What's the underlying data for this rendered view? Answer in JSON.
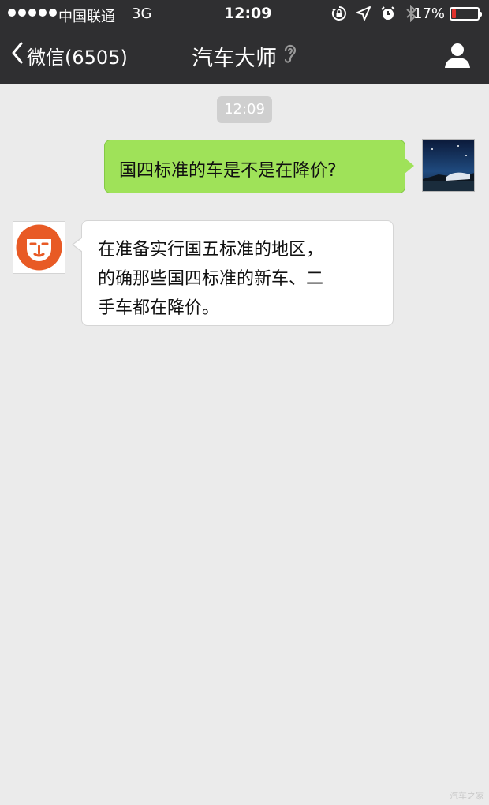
{
  "status_bar": {
    "carrier": "中国联通",
    "network": "3G",
    "time": "12:09",
    "battery_text": "17%",
    "battery_level": 0.17,
    "battery_color": "#e0322d",
    "icons": [
      "signal-dots-icon",
      "rotation-lock-icon",
      "location-arrow-icon",
      "alarm-icon",
      "bluetooth-icon",
      "battery-icon"
    ]
  },
  "nav": {
    "back_label": "微信(6505)",
    "title": "汽车大师",
    "title_icon": "earpiece-icon",
    "right_icon": "person-icon"
  },
  "chat": {
    "timestamp": "12:09",
    "messages": [
      {
        "direction": "outgoing",
        "text": "国四标准的车是不是在降价?",
        "avatar": "user-photo-avatar",
        "bubble_color": "#9fe259"
      },
      {
        "direction": "incoming",
        "lines": [
          "在准备实行国五标准的地区，",
          "的确那些国四标准的新车、二",
          "手车都在降价。"
        ],
        "avatar": "lion-logo-avatar",
        "bubble_color": "#ffffff"
      }
    ]
  },
  "watermark": "汽车之家",
  "colors": {
    "header": "#2f2f31",
    "background": "#ebebeb",
    "timestamp_bg": "#cfcfcf"
  }
}
